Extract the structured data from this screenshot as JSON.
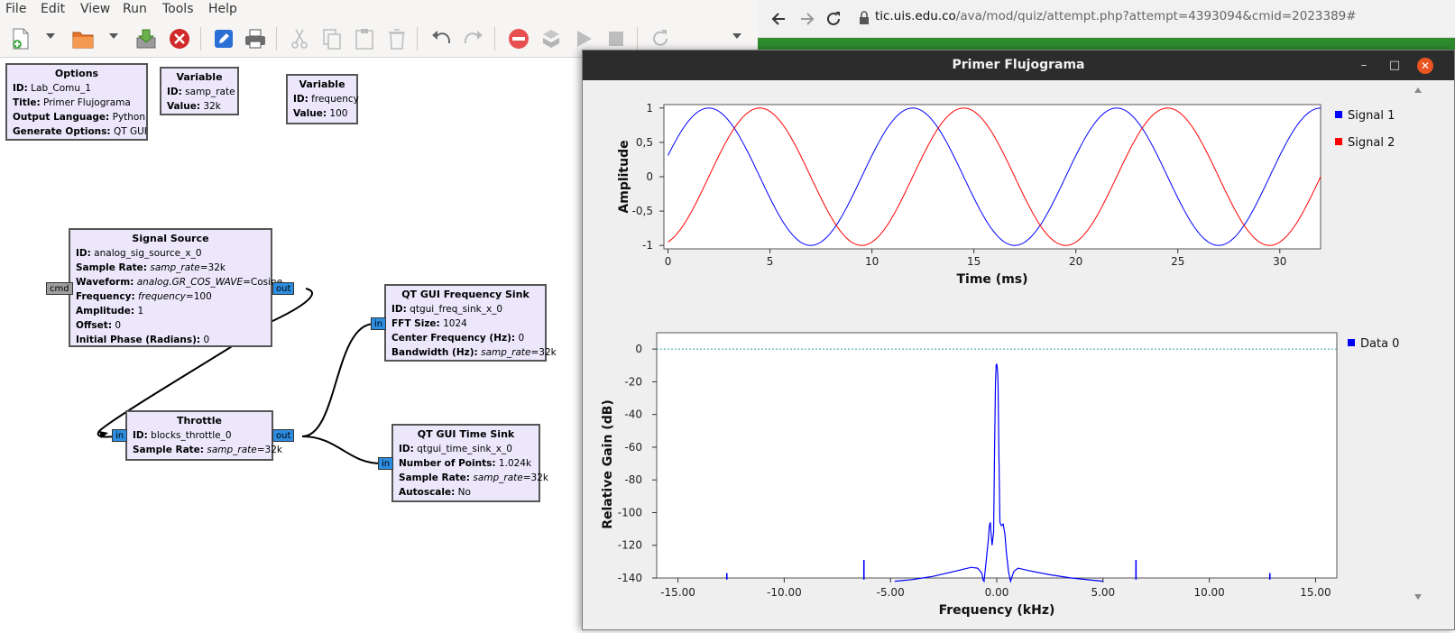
{
  "grc": {
    "menu": [
      "File",
      "Edit",
      "View",
      "Run",
      "Tools",
      "Help"
    ],
    "toolbar_icons": [
      "new-file-icon",
      "open-folder-icon",
      "save-icon",
      "close-icon",
      "edit-icon",
      "print-icon",
      "cut-icon",
      "copy-icon",
      "paste-icon",
      "delete-icon",
      "undo-icon",
      "redo-icon",
      "kill-icon",
      "generate-icon",
      "run-icon",
      "stop-icon",
      "reload-icon"
    ],
    "blocks": {
      "options": {
        "title": "Options",
        "rows": [
          {
            "k": "ID:",
            "v": "Lab_Comu_1"
          },
          {
            "k": "Title:",
            "v": "Primer Flujograma"
          },
          {
            "k": "Output Language:",
            "v": "Python"
          },
          {
            "k": "Generate Options:",
            "v": "QT GUI"
          }
        ]
      },
      "var_samp_rate": {
        "title": "Variable",
        "rows": [
          {
            "k": "ID:",
            "v": "samp_rate"
          },
          {
            "k": "Value:",
            "v": "32k"
          }
        ]
      },
      "var_frequency": {
        "title": "Variable",
        "rows": [
          {
            "k": "ID:",
            "v": "frequency"
          },
          {
            "k": "Value:",
            "v": "100"
          }
        ]
      },
      "signal_source": {
        "title": "Signal Source",
        "rows": [
          {
            "k": "ID:",
            "v": "analog_sig_source_x_0"
          },
          {
            "k": "Sample Rate:",
            "vi": "samp_rate",
            "v": "=32k"
          },
          {
            "k": "Waveform:",
            "vi": "analog.GR_COS_WAVE",
            "v": "=Cosine"
          },
          {
            "k": "Frequency:",
            "vi": "frequency",
            "v": "=100"
          },
          {
            "k": "Amplitude:",
            "v": "1"
          },
          {
            "k": "Offset:",
            "v": "0"
          },
          {
            "k": "Initial Phase (Radians):",
            "v": "0"
          }
        ],
        "ports": {
          "in": "cmd",
          "out": "out"
        }
      },
      "throttle": {
        "title": "Throttle",
        "rows": [
          {
            "k": "ID:",
            "v": "blocks_throttle_0"
          },
          {
            "k": "Sample Rate:",
            "vi": "samp_rate",
            "v": "=32k"
          }
        ],
        "ports": {
          "in": "in",
          "out": "out"
        }
      },
      "freq_sink": {
        "title": "QT GUI Frequency Sink",
        "rows": [
          {
            "k": "ID:",
            "v": "qtgui_freq_sink_x_0"
          },
          {
            "k": "FFT Size:",
            "v": "1024"
          },
          {
            "k": "Center Frequency (Hz):",
            "v": "0"
          },
          {
            "k": "Bandwidth (Hz):",
            "vi": "samp_rate",
            "v": "=32k"
          }
        ],
        "ports": {
          "in": "in"
        }
      },
      "time_sink": {
        "title": "QT GUI Time Sink",
        "rows": [
          {
            "k": "ID:",
            "v": "qtgui_time_sink_x_0"
          },
          {
            "k": "Number of Points:",
            "v": "1.024k"
          },
          {
            "k": "Sample Rate:",
            "vi": "samp_rate",
            "v": "=32k"
          },
          {
            "k": "Autoscale:",
            "v": "No"
          }
        ],
        "ports": {
          "in": "in"
        }
      }
    }
  },
  "browser": {
    "url_host": "tic.uis.edu.co",
    "url_path": "/ava/mod/quiz/attempt.php?attempt=4393094&cmid=2023389#"
  },
  "plot_window": {
    "title": "Primer Flujograma",
    "accent_close": "#e95420"
  },
  "chart_data": [
    {
      "type": "line",
      "xlabel": "Time (ms)",
      "ylabel": "Amplitude",
      "xlim": [
        -0.2,
        32
      ],
      "ylim": [
        -1.05,
        1.05
      ],
      "xticks": [
        "0",
        "5",
        "10",
        "15",
        "20",
        "25",
        "30"
      ],
      "yticks": [
        "1",
        "0,5",
        "0",
        "-0,5",
        "-1"
      ],
      "legend_position": "right",
      "series": [
        {
          "name": "Signal 1",
          "color": "#0000ff",
          "frequency_hz": 100,
          "phase_offset_ms": 2.0,
          "x_range_ms": [
            0,
            32
          ]
        },
        {
          "name": "Signal 2",
          "color": "#ff0000",
          "frequency_hz": 100,
          "phase_offset_ms": 4.5,
          "x_range_ms": [
            0,
            32
          ]
        }
      ]
    },
    {
      "type": "line",
      "xlabel": "Frequency (kHz)",
      "ylabel": "Relative Gain (dB)",
      "xlim": [
        -16,
        16
      ],
      "ylim": [
        -140,
        10
      ],
      "xticks": [
        "-15.00",
        "-10.00",
        "-5.00",
        "0.00",
        "5.00",
        "10.00",
        "15.00"
      ],
      "yticks": [
        "0",
        "-20",
        "-40",
        "-60",
        "-80",
        "-100",
        "-120",
        "-140"
      ],
      "legend_position": "right",
      "reference_line_db": 0,
      "series": [
        {
          "name": "Data 0",
          "color": "#0000ff",
          "points": [
            [
              -4.8,
              -142
            ],
            [
              -4.0,
              -141
            ],
            [
              -3.0,
              -139
            ],
            [
              -2.0,
              -136
            ],
            [
              -1.2,
              -133.5
            ],
            [
              -0.9,
              -134
            ],
            [
              -0.7,
              -137
            ],
            [
              -0.65,
              -141
            ],
            [
              -0.6,
              -142
            ],
            [
              -0.5,
              -130
            ],
            [
              -0.4,
              -117
            ],
            [
              -0.35,
              -108
            ],
            [
              -0.3,
              -106
            ],
            [
              -0.27,
              -112
            ],
            [
              -0.22,
              -120
            ],
            [
              -0.15,
              -112
            ],
            [
              -0.1,
              -60
            ],
            [
              -0.06,
              -20
            ],
            [
              -0.03,
              -10
            ],
            [
              0.0,
              -9
            ],
            [
              0.03,
              -12
            ],
            [
              0.06,
              -20
            ],
            [
              0.1,
              -65
            ],
            [
              0.15,
              -106
            ],
            [
              0.22,
              -108
            ],
            [
              0.3,
              -107
            ],
            [
              0.38,
              -113
            ],
            [
              0.45,
              -124
            ],
            [
              0.55,
              -136
            ],
            [
              0.65,
              -142
            ],
            [
              0.8,
              -136
            ],
            [
              1.0,
              -134
            ],
            [
              1.5,
              -135.5
            ],
            [
              2.5,
              -138
            ],
            [
              3.5,
              -140
            ],
            [
              5.0,
              -142
            ]
          ],
          "spurs": [
            {
              "x": -12.7,
              "y": -137
            },
            {
              "x": -6.25,
              "y": -129
            },
            {
              "x": 6.55,
              "y": -129
            },
            {
              "x": 12.85,
              "y": -137
            }
          ]
        }
      ]
    }
  ]
}
